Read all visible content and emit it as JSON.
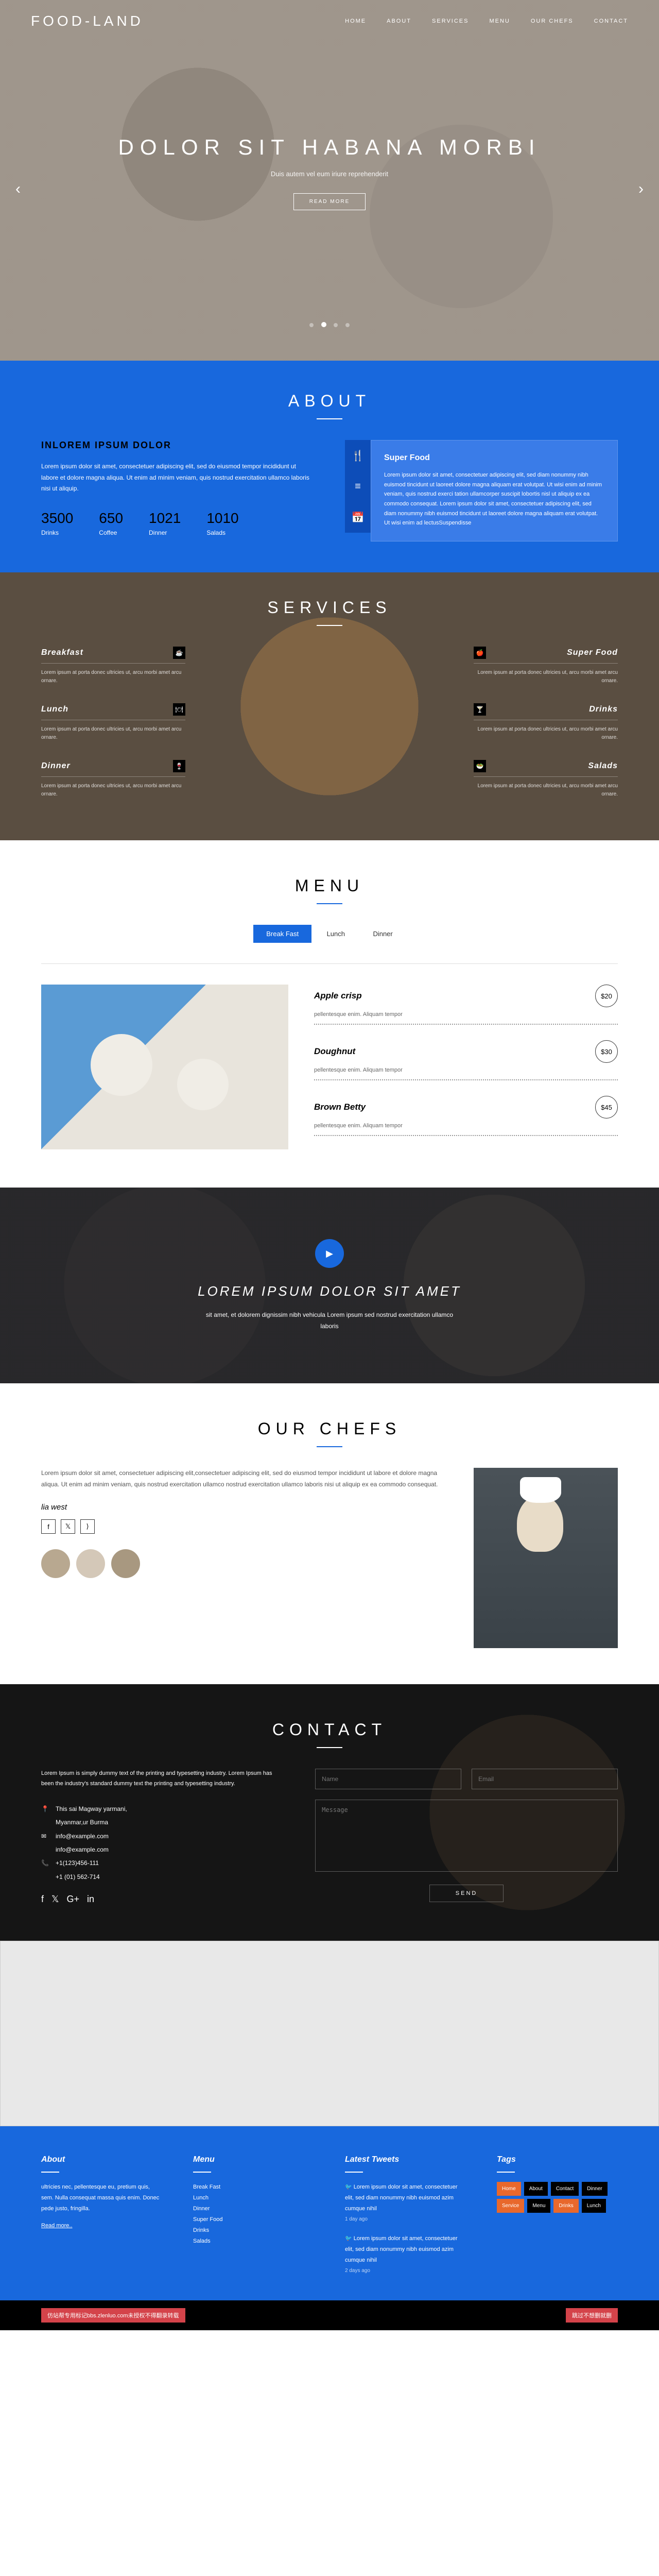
{
  "nav": {
    "logo": "FOOD-LAND",
    "links": [
      "HOME",
      "ABOUT",
      "SERVICES",
      "MENU",
      "OUR CHEFS",
      "CONTACT"
    ]
  },
  "hero": {
    "title": "DOLOR SIT HABANA MORBI",
    "sub": "Duis autem vel eum iriure reprehenderit",
    "btn": "READ MORE"
  },
  "about": {
    "title": "ABOUT",
    "heading": "INLOREM IPSUM DOLOR",
    "text": "Lorem ipsum dolor sit amet, consectetuer adipiscing elit, sed do eiusmod tempor incididunt ut labore et dolore magna aliqua. Ut enim ad minim veniam, quis nostrud exercitation ullamco laboris nisi ut aliquip.",
    "stats": [
      {
        "num": "3500",
        "label": "Drinks"
      },
      {
        "num": "650",
        "label": "Coffee"
      },
      {
        "num": "1021",
        "label": "Dinner"
      },
      {
        "num": "1010",
        "label": "Salads"
      }
    ],
    "feature": {
      "title": "Super Food",
      "text": "Lorem ipsum dolor sit amet, consectetuer adipiscing elit, sed diam nonummy nibh euismod tincidunt ut laoreet dolore magna aliquam erat volutpat. Ut wisi enim ad minim veniam, quis nostrud exerci tation ullamcorper suscipit lobortis nisl ut aliquip ex ea commodo consequat. Lorem ipsum dolor sit amet, consectetuer adipiscing elit, sed diam nonummy nibh euismod tincidunt ut laoreet dolore magna aliquam erat volutpat. Ut wisi enim ad lectusSuspendisse"
    }
  },
  "services": {
    "title": "SERVICES",
    "left": [
      {
        "name": "Breakfast",
        "icon": "☕",
        "text": "Lorem ipsum at porta donec ultricies ut, arcu morbi amet arcu ornare."
      },
      {
        "name": "Lunch",
        "icon": "🍽",
        "text": "Lorem ipsum at porta donec ultricies ut, arcu morbi amet arcu ornare."
      },
      {
        "name": "Dinner",
        "icon": "🍷",
        "text": "Lorem ipsum at porta donec ultricies ut, arcu morbi amet arcu ornare."
      }
    ],
    "right": [
      {
        "name": "Super Food",
        "icon": "🍎",
        "text": "Lorem ipsum at porta donec ultricies ut, arcu morbi amet arcu ornare."
      },
      {
        "name": "Drinks",
        "icon": "🍸",
        "text": "Lorem ipsum at porta donec ultricies ut, arcu morbi amet arcu ornare."
      },
      {
        "name": "Salads",
        "icon": "🥗",
        "text": "Lorem ipsum at porta donec ultricies ut, arcu morbi amet arcu ornare."
      }
    ]
  },
  "menu": {
    "title": "MENU",
    "tabs": [
      "Break Fast",
      "Lunch",
      "Dinner"
    ],
    "items": [
      {
        "name": "Apple crisp",
        "desc": "pellentesque enim. Aliquam tempor",
        "price": "$20"
      },
      {
        "name": "Doughnut",
        "desc": "pellentesque enim. Aliquam tempor",
        "price": "$30"
      },
      {
        "name": "Brown Betty",
        "desc": "pellentesque enim. Aliquam tempor",
        "price": "$45"
      }
    ]
  },
  "video": {
    "title": "LOREM IPSUM DOLOR SIT AMET",
    "text": "sit amet, et dolorem dignissim nibh vehicula Lorem ipsum\nsed nostrud exercitation ullamco laboris"
  },
  "chefs": {
    "title": "OUR CHEFS",
    "text": "Lorem ipsum dolor sit amet, consectetuer adipiscing elit,consectetuer adipiscing elit, sed do eiusmod tempor incididunt ut labore et dolore magna aliqua. Ut enim ad minim veniam, quis nostrud exercitation ullamco nostrud exercitation ullamco laboris nisi ut aliquip ex ea commodo consequat.",
    "name": "lia west"
  },
  "contact": {
    "title": "CONTACT",
    "text": "Lorem Ipsum is simply dummy text of the printing and typesetting industry. Lorem Ipsum has been the industry's standard dummy text the printing and typesetting industry.",
    "address": "This sai Magway yarmani,\nMyanmar,ur Burma",
    "email1": "info@example.com",
    "email2": "info@example.com",
    "phone1": "+1(123)456-111",
    "phone2": "+1 (01) 562-714",
    "name_ph": "Name",
    "email_ph": "Email",
    "msg_ph": "Message",
    "send": "SEND"
  },
  "footer": {
    "about": {
      "title": "About",
      "text": "ultricies nec, pellentesque eu, pretium quis, sem. Nulla consequat massa quis enim. Donec pede justo, fringilla.",
      "more": "Read more.."
    },
    "menu": {
      "title": "Menu",
      "items": [
        "Break Fast",
        "Lunch",
        "Dinner",
        "Super Food",
        "Drinks",
        "Salads"
      ]
    },
    "tweets": {
      "title": "Latest Tweets",
      "items": [
        {
          "text": "Lorem ipsum dolor sit amet, consectetuer elit, sed diam nonummy nibh euismod azim cumque nihil",
          "time": "1 day ago"
        },
        {
          "text": "Lorem ipsum dolor sit amet, consectetuer elit, sed diam nonummy nibh euismod azim cumque nihil",
          "time": "2 days ago"
        }
      ]
    },
    "tags": {
      "title": "Tags",
      "items": [
        {
          "t": "Home",
          "c": "orange"
        },
        {
          "t": "About",
          "c": ""
        },
        {
          "t": "Contact",
          "c": ""
        },
        {
          "t": "Dinner",
          "c": ""
        },
        {
          "t": "Service",
          "c": "orange"
        },
        {
          "t": "Menu",
          "c": ""
        },
        {
          "t": "Drinks",
          "c": "orange"
        },
        {
          "t": "Lunch",
          "c": ""
        }
      ]
    }
  },
  "copyright": {
    "left": "仿站帮专用标记bbs.zlenluo.com未授权不得翻录转载",
    "right": "跳过不想删就删"
  }
}
